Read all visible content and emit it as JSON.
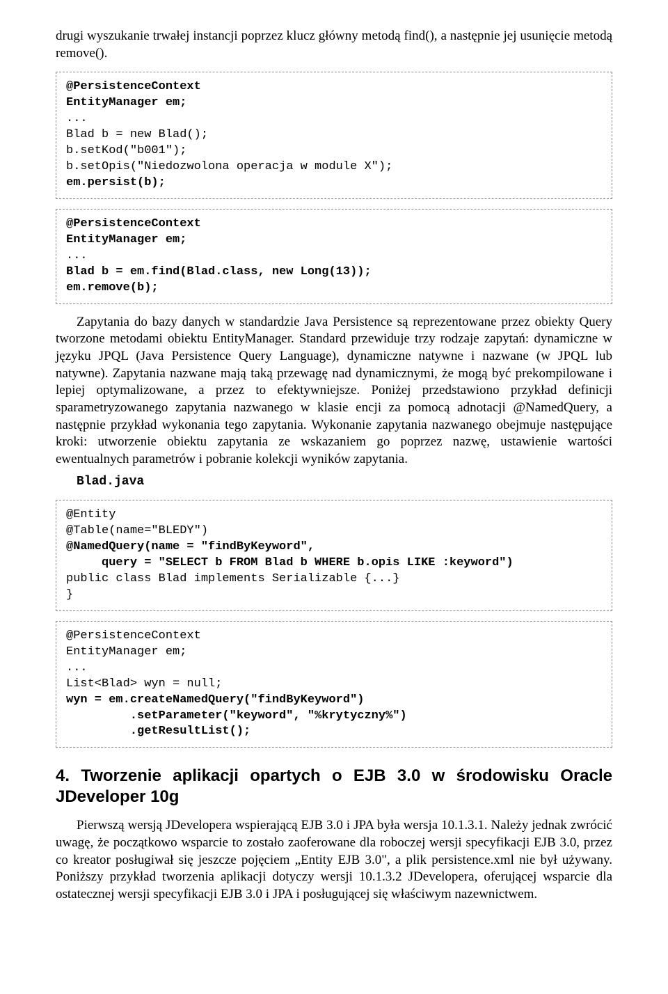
{
  "para_intro": "drugi wyszukanie trwałej instancji poprzez klucz główny metodą find(), a następnie jej usunięcie metodą remove().",
  "code1": {
    "l1": "@PersistenceContext",
    "l2": "EntityManager em;",
    "l3": "...",
    "l4": "Blad b = new Blad();",
    "l5": "b.setKod(\"b001\");",
    "l6": "b.setOpis(\"Niedozwolona operacja w module X\");",
    "l7": "em.persist(b);"
  },
  "code2": {
    "l1": "@PersistenceContext",
    "l2": "EntityManager em;",
    "l3": "...",
    "l4": "Blad b = em.find(Blad.class, new Long(13));",
    "l5": "em.remove(b);"
  },
  "para_body": "Zapytania do bazy danych w standardzie Java Persistence są reprezentowane przez obiekty Query tworzone metodami obiektu EntityManager. Standard przewiduje trzy rodzaje zapytań: dynamiczne w języku JPQL (Java Persistence Query Language), dynamiczne natywne i nazwane (w JPQL lub natywne). Zapytania nazwane mają taką przewagę nad dynamicznymi, że mogą być prekompilowane i lepiej optymalizowane, a przez to efektywniejsze. Poniżej przedstawiono przykład definicji sparametryzowanego zapytania nazwanego w klasie encji za pomocą adnotacji @NamedQuery, a następnie przykład wykonania tego zapytania. Wykonanie zapytania nazwanego obejmuje następujące kroki: utworzenie obiektu zapytania ze wskazaniem go poprzez nazwę, ustawienie wartości ewentualnych parametrów i pobranie kolekcji wyników zapytania.",
  "filename": "Blad.java",
  "code3": {
    "l1": "@Entity",
    "l2": "@Table(name=\"BLEDY\")",
    "l3": "@NamedQuery(name = \"findByKeyword\",",
    "l4": "     query = \"SELECT b FROM Blad b WHERE b.opis LIKE :keyword\")",
    "l5": "public class Blad implements Serializable {...}",
    "l6": "}"
  },
  "code4": {
    "l1": "@PersistenceContext",
    "l2": "EntityManager em;",
    "l3": "...",
    "l4": "List<Blad> wyn = null;",
    "l5": "wyn = em.createNamedQuery(\"findByKeyword\")",
    "l6": "         .setParameter(\"keyword\", \"%krytyczny%\")",
    "l7": "         .getResultList();"
  },
  "heading": "4. Tworzenie aplikacji opartych o EJB 3.0 w środowisku Oracle JDeveloper 10g",
  "para_end": "Pierwszą wersją JDevelopera wspierającą EJB 3.0 i JPA była wersja 10.1.3.1. Należy jednak zwrócić uwagę, że początkowo wsparcie to zostało zaoferowane dla roboczej wersji specyfikacji EJB 3.0, przez co kreator posługiwał się jeszcze pojęciem „Entity EJB 3.0\", a plik persistence.xml nie był używany. Poniższy przykład tworzenia aplikacji dotyczy wersji 10.1.3.2 JDevelopera, oferującej wsparcie dla ostatecznej wersji specyfikacji EJB 3.0 i JPA i posługującej się właściwym nazewnictwem."
}
